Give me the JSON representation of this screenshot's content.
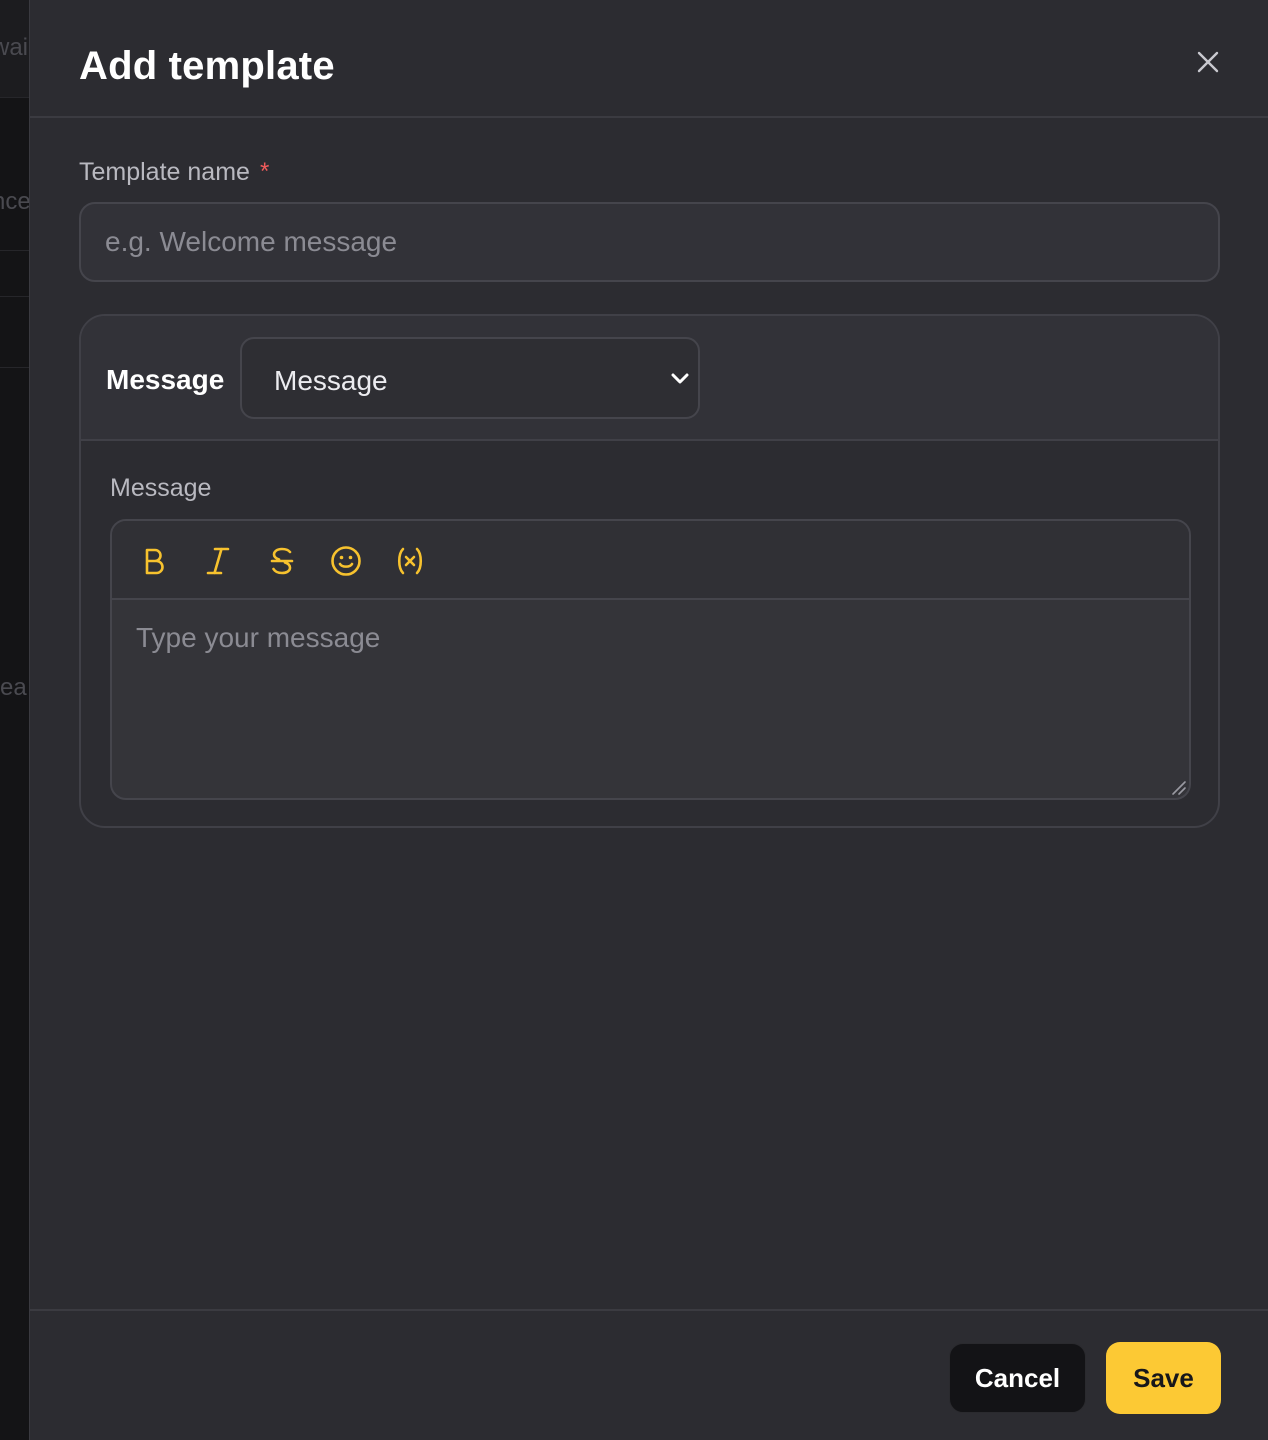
{
  "background": {
    "fragments": [
      "wai",
      "nce",
      "rea"
    ]
  },
  "dialog": {
    "title": "Add template",
    "close_icon": "close-icon"
  },
  "template_name": {
    "label": "Template name",
    "required_mark": "*",
    "placeholder": "e.g. Welcome message",
    "value": ""
  },
  "message_card": {
    "header_label": "Message",
    "type_select": {
      "selected": "Message",
      "icon": "chevron-down-icon"
    },
    "body_label": "Message",
    "toolbar": [
      {
        "name": "bold-icon"
      },
      {
        "name": "italic-icon"
      },
      {
        "name": "strikethrough-icon"
      },
      {
        "name": "emoji-icon"
      },
      {
        "name": "variable-icon"
      }
    ],
    "editor_placeholder": "Type your message"
  },
  "footer": {
    "cancel_label": "Cancel",
    "save_label": "Save"
  },
  "colors": {
    "accent": "#fcc934",
    "panel_bg": "#2c2c31",
    "required": "#f05b5b"
  }
}
